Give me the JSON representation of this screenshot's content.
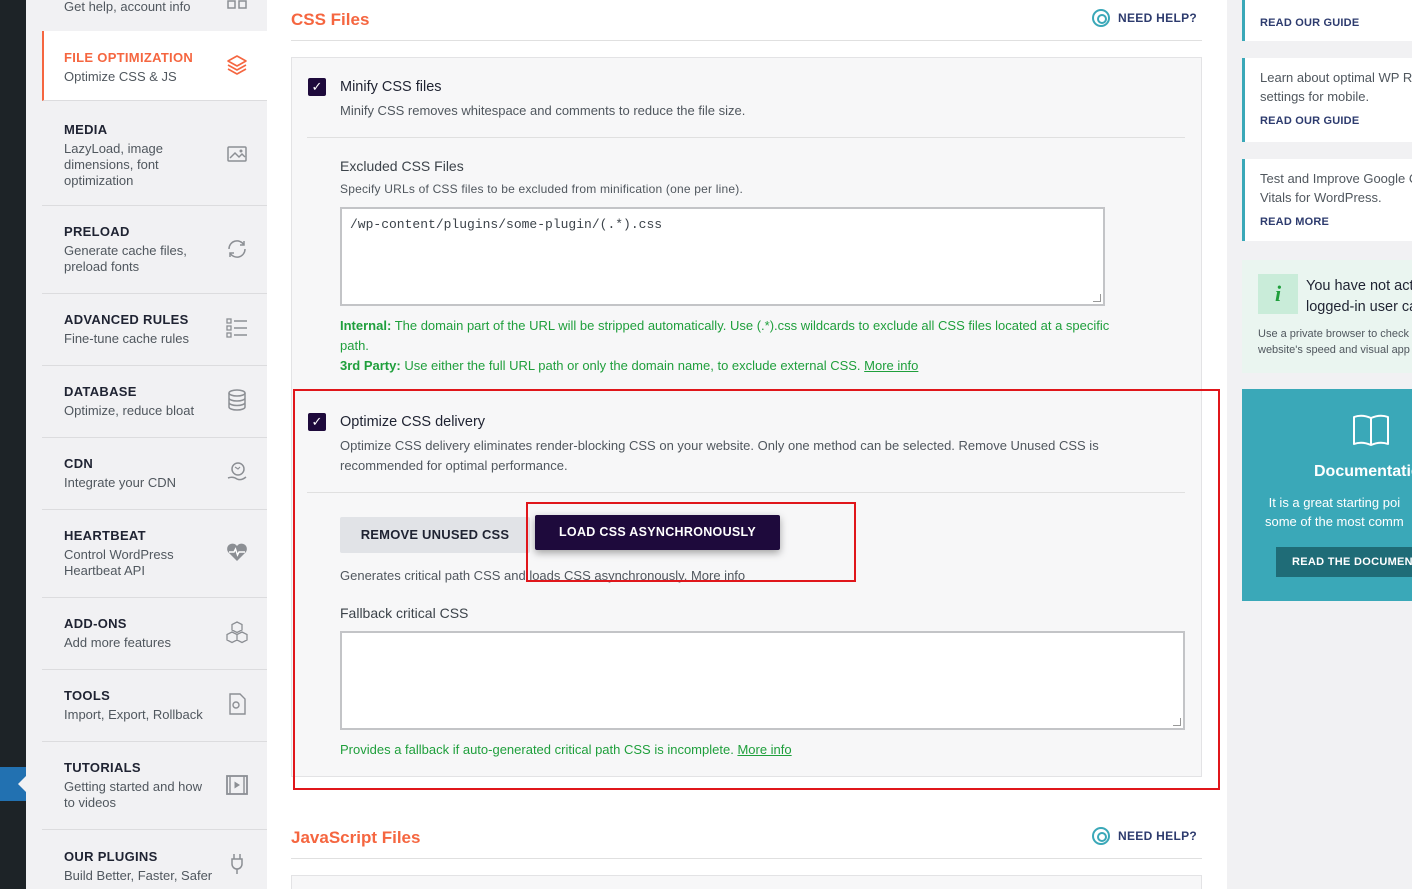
{
  "nav": {
    "top_partial": "Get help, account info",
    "items": [
      {
        "title": "FILE OPTIMIZATION",
        "desc": "Optimize CSS & JS",
        "icon": "layers-icon"
      },
      {
        "title": "MEDIA",
        "desc": "LazyLoad, image dimensions, font optimization",
        "icon": "image-icon"
      },
      {
        "title": "PRELOAD",
        "desc": "Generate cache files, preload fonts",
        "icon": "refresh-icon"
      },
      {
        "title": "ADVANCED RULES",
        "desc": "Fine-tune cache rules",
        "icon": "list-icon"
      },
      {
        "title": "DATABASE",
        "desc": "Optimize, reduce bloat",
        "icon": "database-icon"
      },
      {
        "title": "CDN",
        "desc": "Integrate your CDN",
        "icon": "globe-hand-icon"
      },
      {
        "title": "HEARTBEAT",
        "desc": "Control WordPress Heartbeat API",
        "icon": "heartbeat-icon"
      },
      {
        "title": "ADD-ONS",
        "desc": "Add more features",
        "icon": "cubes-icon"
      },
      {
        "title": "TOOLS",
        "desc": "Import, Export, Rollback",
        "icon": "gear-file-icon"
      },
      {
        "title": "TUTORIALS",
        "desc": "Getting started and how to videos",
        "icon": "video-icon"
      },
      {
        "title": "OUR PLUGINS",
        "desc": "Build Better, Faster, Safer",
        "icon": "plug-icon"
      }
    ]
  },
  "css_section": {
    "title": "CSS Files",
    "need_help": "NEED HELP?",
    "minify": {
      "label": "Minify CSS files",
      "desc": "Minify CSS removes whitespace and comments to reduce the file size.",
      "checked": true
    },
    "excluded": {
      "label": "Excluded CSS Files",
      "desc": "Specify URLs of CSS files to be excluded from minification (one per line).",
      "value": "/wp-content/plugins/some-plugin/(.*).css",
      "internal_label": "Internal:",
      "internal_text": "The domain part of the URL will be stripped automatically. Use (.*).css wildcards to exclude all CSS files located at a specific path.",
      "third_label": "3rd Party:",
      "third_text": "Use either the full URL path or only the domain name, to exclude external CSS.",
      "more_info": "More info"
    },
    "optimize": {
      "label": "Optimize CSS delivery",
      "desc": "Optimize CSS delivery eliminates render-blocking CSS on your website. Only one method can be selected. Remove Unused CSS is recommended for optimal performance.",
      "checked": true,
      "btn_remove": "REMOVE UNUSED CSS",
      "btn_async": "LOAD CSS ASYNCHRONOUSLY",
      "method_desc": "Generates critical path CSS and loads CSS asynchronously.",
      "method_more": "More info",
      "fallback_label": "Fallback critical CSS",
      "fallback_value": "",
      "fallback_desc": "Provides a fallback if auto-generated critical path CSS is incomplete.",
      "fallback_more": "More info"
    }
  },
  "js_section": {
    "title": "JavaScript Files",
    "need_help": "NEED HELP?"
  },
  "sidebar": {
    "cards": [
      {
        "text": "",
        "link": "READ OUR GUIDE"
      },
      {
        "text": "Learn about optimal WP R settings for mobile.",
        "link": "READ OUR GUIDE"
      },
      {
        "text": "Test and Improve Google C Vitals for WordPress.",
        "link": "READ MORE"
      }
    ],
    "notice_title_1": "You have not acti",
    "notice_title_2": "logged-in user ca",
    "notice_desc_1": "Use a private browser to check",
    "notice_desc_2": "website's speed and visual app",
    "doc_title": "Documentation",
    "doc_desc_1": "It is a great starting poi",
    "doc_desc_2": "some of the most comm",
    "doc_button": "READ THE DOCUMENTATI"
  },
  "colors": {
    "accent": "#f56640",
    "dark": "#1e0a3c",
    "green": "#1f9f3c",
    "teal": "#3aa8b8"
  }
}
